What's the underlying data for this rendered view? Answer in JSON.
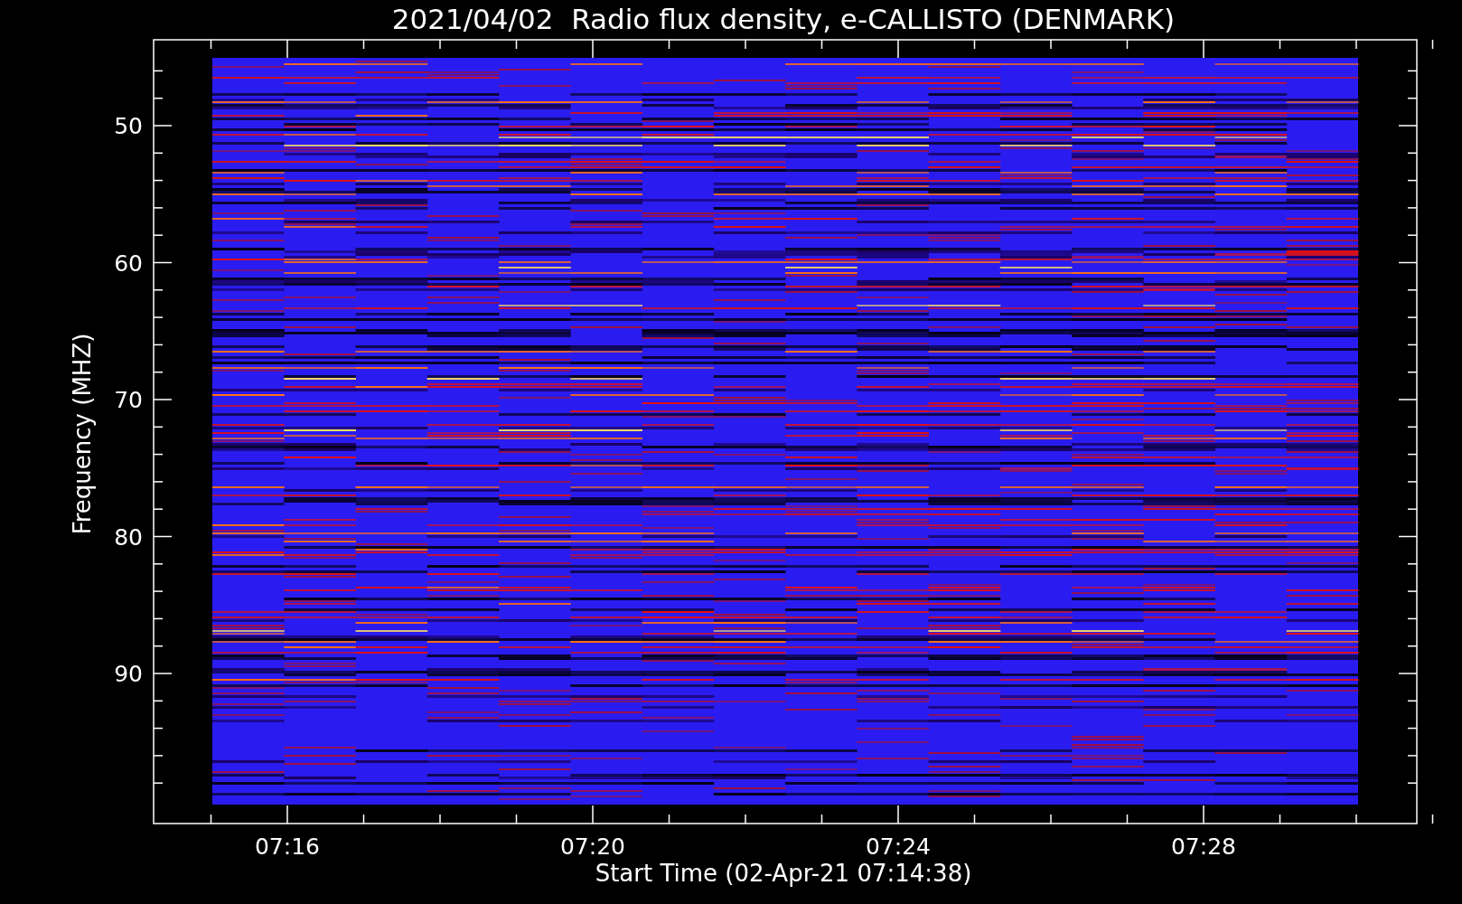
{
  "title": "2021/04/02  Radio flux density, e-CALLISTO (DENMARK)",
  "y_axis": {
    "label": "Frequency (MHZ)",
    "tick_labels": [
      "50",
      "60",
      "70",
      "80",
      "90"
    ]
  },
  "x_axis": {
    "label": "Start Time (02-Apr-21 07:14:38)",
    "tick_labels": [
      "07:16",
      "07:20",
      "07:24",
      "07:28"
    ]
  }
}
